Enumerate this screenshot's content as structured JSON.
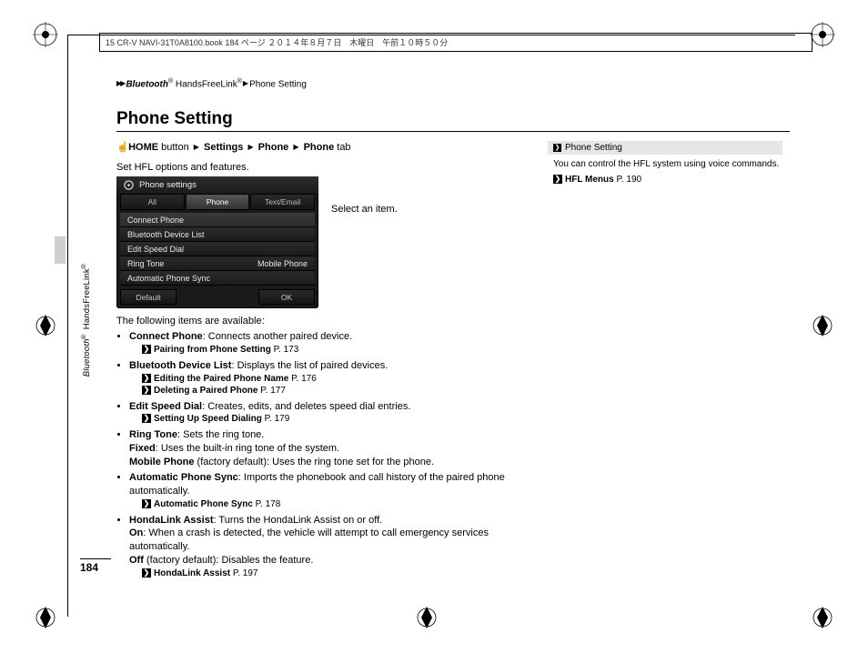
{
  "doc_header": "15 CR-V NAVI-31T0A8100.book  184 ページ  ２０１４年８月７日　木曜日　午前１０時５０分",
  "breadcrumb": {
    "a": "Bluetooth",
    "reg1": "®",
    "b": " HandsFreeLink",
    "reg2": "®",
    "c": "Phone Setting"
  },
  "title": "Phone Setting",
  "nav": {
    "home": "HOME",
    "home_suffix": " button",
    "settings": "Settings",
    "phone1": "Phone",
    "phone2": "Phone",
    "tab": " tab"
  },
  "intro": "Set HFL options and features.",
  "select_item": "Select an item.",
  "screenshot": {
    "title": "Phone settings",
    "tabs": {
      "all": "All",
      "phone": "Phone",
      "textemail": "Text/Email"
    },
    "rows": {
      "connect": "Connect Phone",
      "bdl": "Bluetooth Device List",
      "esd": "Edit Speed Dial",
      "ringtone": "Ring Tone",
      "ringtone_val": "Mobile Phone",
      "aps": "Automatic Phone Sync"
    },
    "foot": {
      "default": "Default",
      "ok": "OK"
    }
  },
  "subhead": "The following items are available:",
  "bullets": {
    "connect": {
      "t": "Connect Phone",
      "d": ": Connects another paired device.",
      "ref": "Pairing from Phone Setting",
      "pg": " P. 173"
    },
    "bdl": {
      "t": "Bluetooth Device List",
      "d": ": Displays the list of paired devices.",
      "ref1": "Editing the Paired Phone Name",
      "pg1": " P. 176",
      "ref2": "Deleting a Paired Phone",
      "pg2": " P. 177"
    },
    "esd": {
      "t": "Edit Speed Dial",
      "d": ": Creates, edits, and deletes speed dial entries.",
      "ref": "Setting Up Speed Dialing",
      "pg": " P. 179"
    },
    "ring": {
      "t": "Ring Tone",
      "d": ": Sets the ring tone.",
      "fixed_t": "Fixed",
      "fixed_d": ": Uses the built-in ring tone of the system.",
      "mobile_t": "Mobile Phone",
      "mobile_d": " (factory default): Uses the ring tone set for the phone."
    },
    "aps": {
      "t": "Automatic Phone Sync",
      "d": ": Imports the phonebook and call history of the paired phone automatically.",
      "ref": "Automatic Phone Sync",
      "pg": " P. 178"
    },
    "hl": {
      "t": "HondaLink Assist",
      "d": ": Turns the HondaLink Assist on or off.",
      "on_t": "On",
      "on_d": ": When a crash is detected, the vehicle will attempt to call emergency services automatically.",
      "off_t": "Off",
      "off_d": " (factory default): Disables the feature.",
      "ref": "HondaLink Assist",
      "pg": " P. 197"
    }
  },
  "side": {
    "head": "Phone Setting",
    "body": "You can control the HFL system using voice commands.",
    "ref": "HFL Menus",
    "pg": " P. 190"
  },
  "pagenum": "184",
  "sidelabel": {
    "a": "Bluetooth",
    "b": " HandsFreeLink"
  }
}
